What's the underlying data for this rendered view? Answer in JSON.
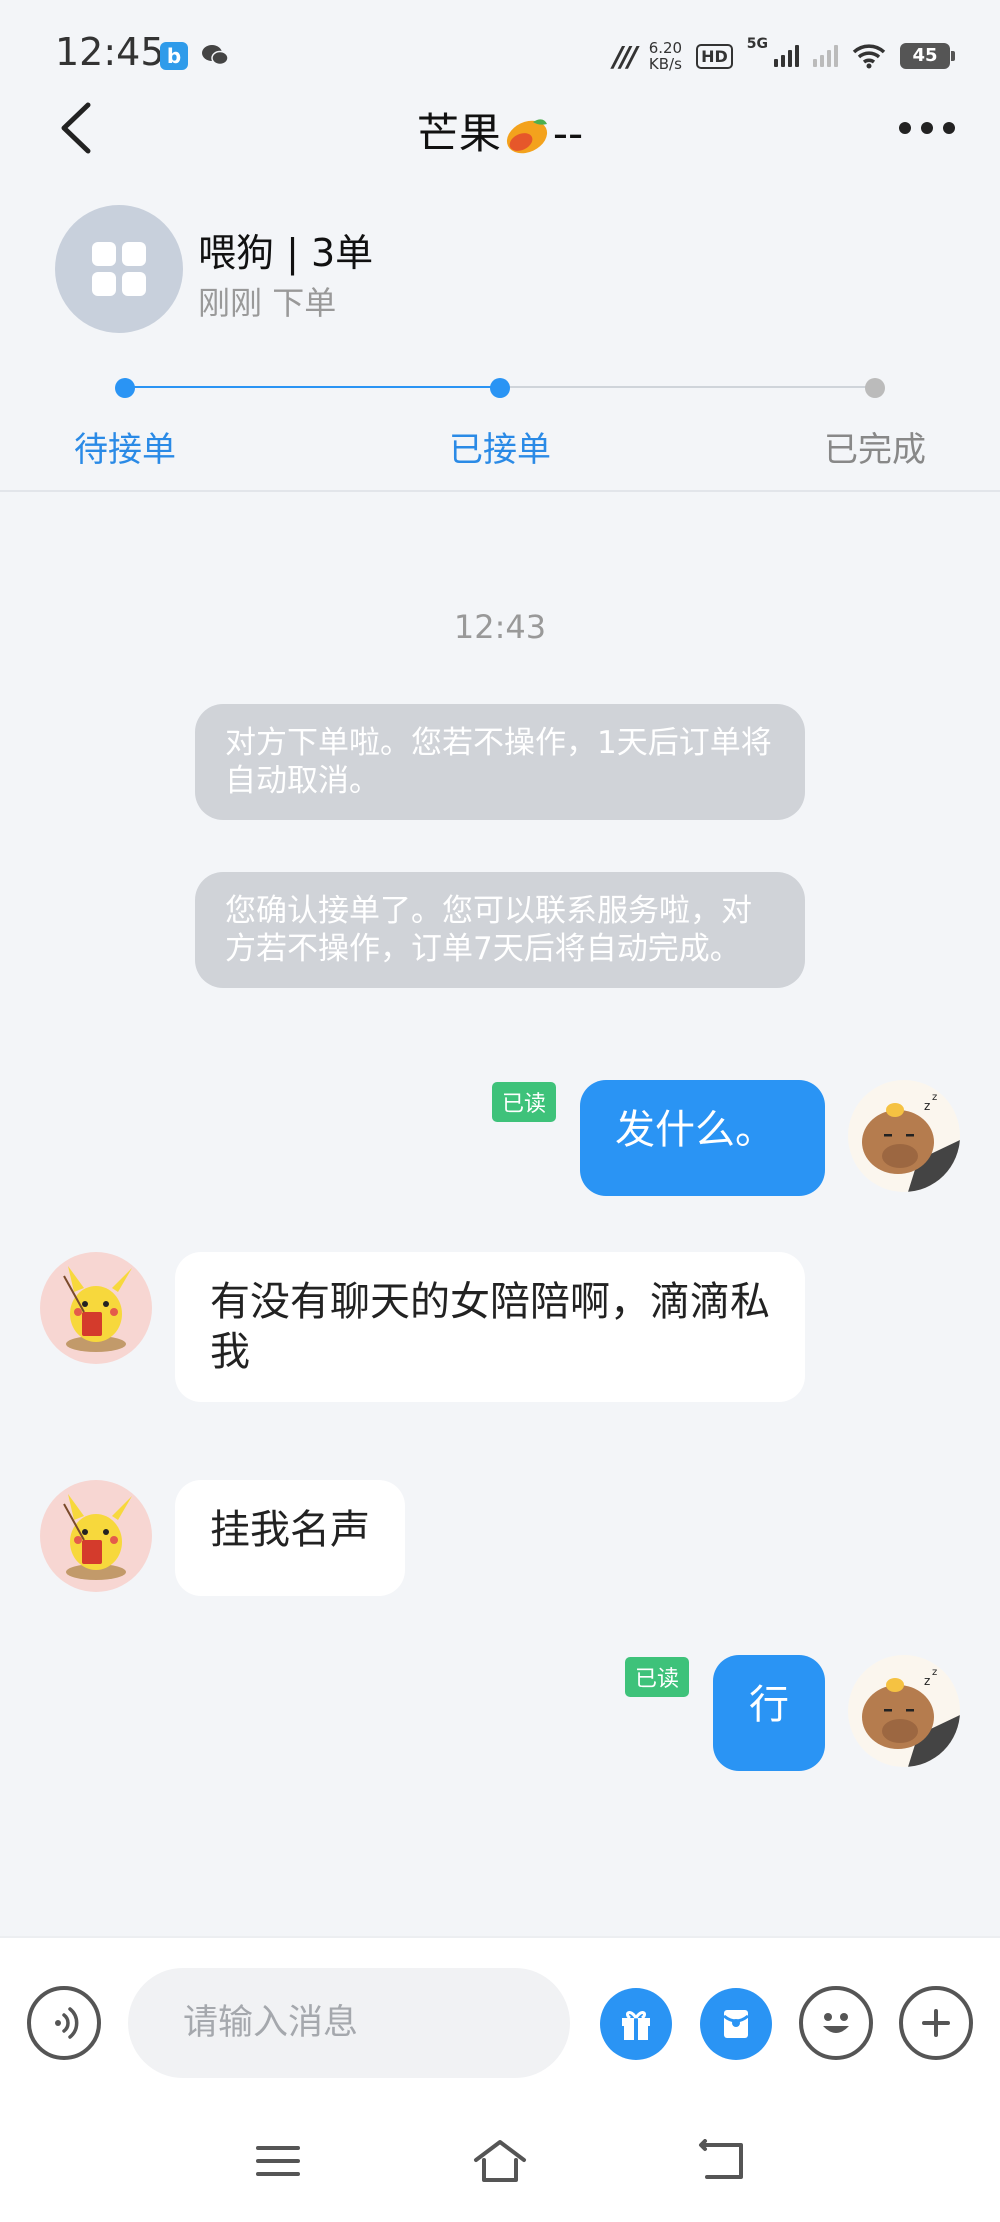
{
  "status_bar": {
    "time": "12:45",
    "net_speed_value": "6.20",
    "net_speed_unit": "KB/s",
    "hd_label": "HD",
    "network_label": "5G",
    "battery": "45",
    "icons": [
      "app-notification-icon",
      "wechat-icon",
      "nfc-icon",
      "hd-icon",
      "signal-icon",
      "wifi-icon",
      "battery-icon"
    ]
  },
  "header": {
    "title_text": "芒果",
    "title_suffix": "--",
    "icons": [
      "back-arrow-icon",
      "mango-emoji-icon",
      "more-dots-icon"
    ]
  },
  "order": {
    "name": "喂狗 | 3单",
    "sub_time": "刚刚",
    "sub_action": "下单",
    "steps": [
      {
        "label": "待接单",
        "state": "done"
      },
      {
        "label": "已接单",
        "state": "current"
      },
      {
        "label": "已完成",
        "state": "pending"
      }
    ],
    "colors": {
      "active": "#2a94f4",
      "inactive": "#bbbbbb",
      "active_text": "#2a8ae6",
      "inactive_text": "#888888"
    }
  },
  "chat": {
    "timestamp": "12:43",
    "system_messages": [
      "对方下单啦。您若不操作，1天后订单将自动取消。",
      "您确认接单了。您可以联系服务啦，对方若不操作，订单7天后将自动完成。"
    ],
    "messages": [
      {
        "from": "me",
        "text": "发什么。",
        "read": "已读"
      },
      {
        "from": "other",
        "text": "有没有聊天的女陪陪啊，滴滴私我"
      },
      {
        "from": "other",
        "text": "挂我名声"
      },
      {
        "from": "me",
        "text": "行",
        "read": "已读"
      }
    ],
    "colors": {
      "my_bubble": "#2a94f4",
      "other_bubble": "#ffffff",
      "read_badge": "#3ec27a",
      "system_bubble": "#d0d3d8"
    }
  },
  "input_bar": {
    "placeholder": "请输入消息",
    "icons": [
      "voice-icon",
      "gift-icon",
      "red-packet-icon",
      "emoji-icon",
      "plus-icon"
    ]
  },
  "nav_bar": {
    "icons": [
      "menu-icon",
      "home-icon",
      "back-icon"
    ]
  }
}
